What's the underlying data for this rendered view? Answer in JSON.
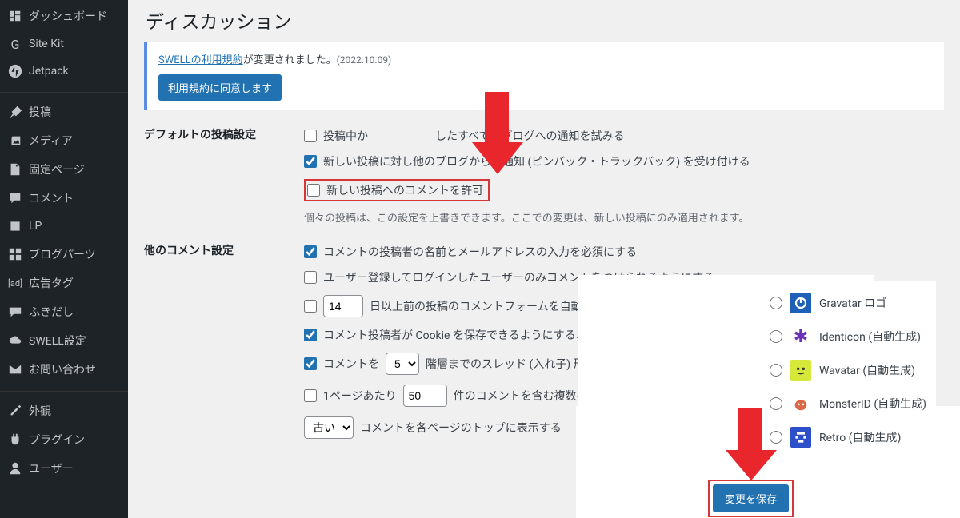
{
  "sidebar": {
    "items": [
      {
        "icon": "dashboard",
        "label": "ダッシュボード"
      },
      {
        "icon": "sitekit",
        "label": "Site Kit"
      },
      {
        "icon": "jetpack",
        "label": "Jetpack"
      },
      {
        "sep": true
      },
      {
        "icon": "pin",
        "label": "投稿"
      },
      {
        "icon": "media",
        "label": "メディア"
      },
      {
        "icon": "page",
        "label": "固定ページ"
      },
      {
        "icon": "comment",
        "label": "コメント"
      },
      {
        "icon": "lp",
        "label": "LP"
      },
      {
        "icon": "parts",
        "label": "ブログパーツ"
      },
      {
        "icon": "ad",
        "label": "広告タグ"
      },
      {
        "icon": "balloon",
        "label": "ふきだし"
      },
      {
        "icon": "swell",
        "label": "SWELL設定"
      },
      {
        "icon": "mail",
        "label": "お問い合わせ"
      },
      {
        "sep": true
      },
      {
        "icon": "brush",
        "label": "外観"
      },
      {
        "icon": "plugin",
        "label": "プラグイン"
      },
      {
        "icon": "user",
        "label": "ユーザー"
      }
    ]
  },
  "page": {
    "title": "ディスカッション",
    "notice_link": "SWELLの利用規約",
    "notice_suffix": "が変更されました。",
    "notice_date": "(2022.10.09)",
    "agree_btn": "利用規約に同意します"
  },
  "defaults": {
    "heading": "デフォルトの投稿設定",
    "opt1": "投稿中か　　　　　　したすべてのブログへの通知を試みる",
    "opt2": "新しい投稿に対し他のブログからの通知 (ピンバック・トラックバック) を受け付ける",
    "opt3": "新しい投稿へのコメントを許可",
    "help": "個々の投稿は、この設定を上書きできます。ここでの変更は、新しい投稿にのみ適用されます。"
  },
  "other": {
    "heading": "他のコメント設定",
    "opt1": "コメントの投稿者の名前とメールアドレスの入力を必須にする",
    "opt2": "ユーザー登録してログインしたユーザーのみコメントをつけられるようにする",
    "opt3_days": "14",
    "opt3_suffix": "日以上前の投稿のコメントフォームを自動的に閉じ",
    "opt4": "コメント投稿者が Cookie を保存できるようにする、Cookie ア",
    "opt5_pre": "コメントを",
    "opt5_levels": "5",
    "opt5_suffix": "階層までのスレッド (入れ子) 形式にする",
    "opt6_pre": "1ページあたり",
    "opt6_count": "50",
    "opt6_suffix": "件のコメントを含む複数ページに分",
    "opt7_select": "古い",
    "opt7_suffix": "コメントを各ページのトップに表示する"
  },
  "avatars": {
    "options": [
      {
        "label": "Gravatar ロゴ"
      },
      {
        "label": "Identicon (自動生成)"
      },
      {
        "label": "Wavatar (自動生成)"
      },
      {
        "label": "MonsterID (自動生成)"
      },
      {
        "label": "Retro (自動生成)"
      }
    ]
  },
  "save": {
    "label": "変更を保存"
  }
}
